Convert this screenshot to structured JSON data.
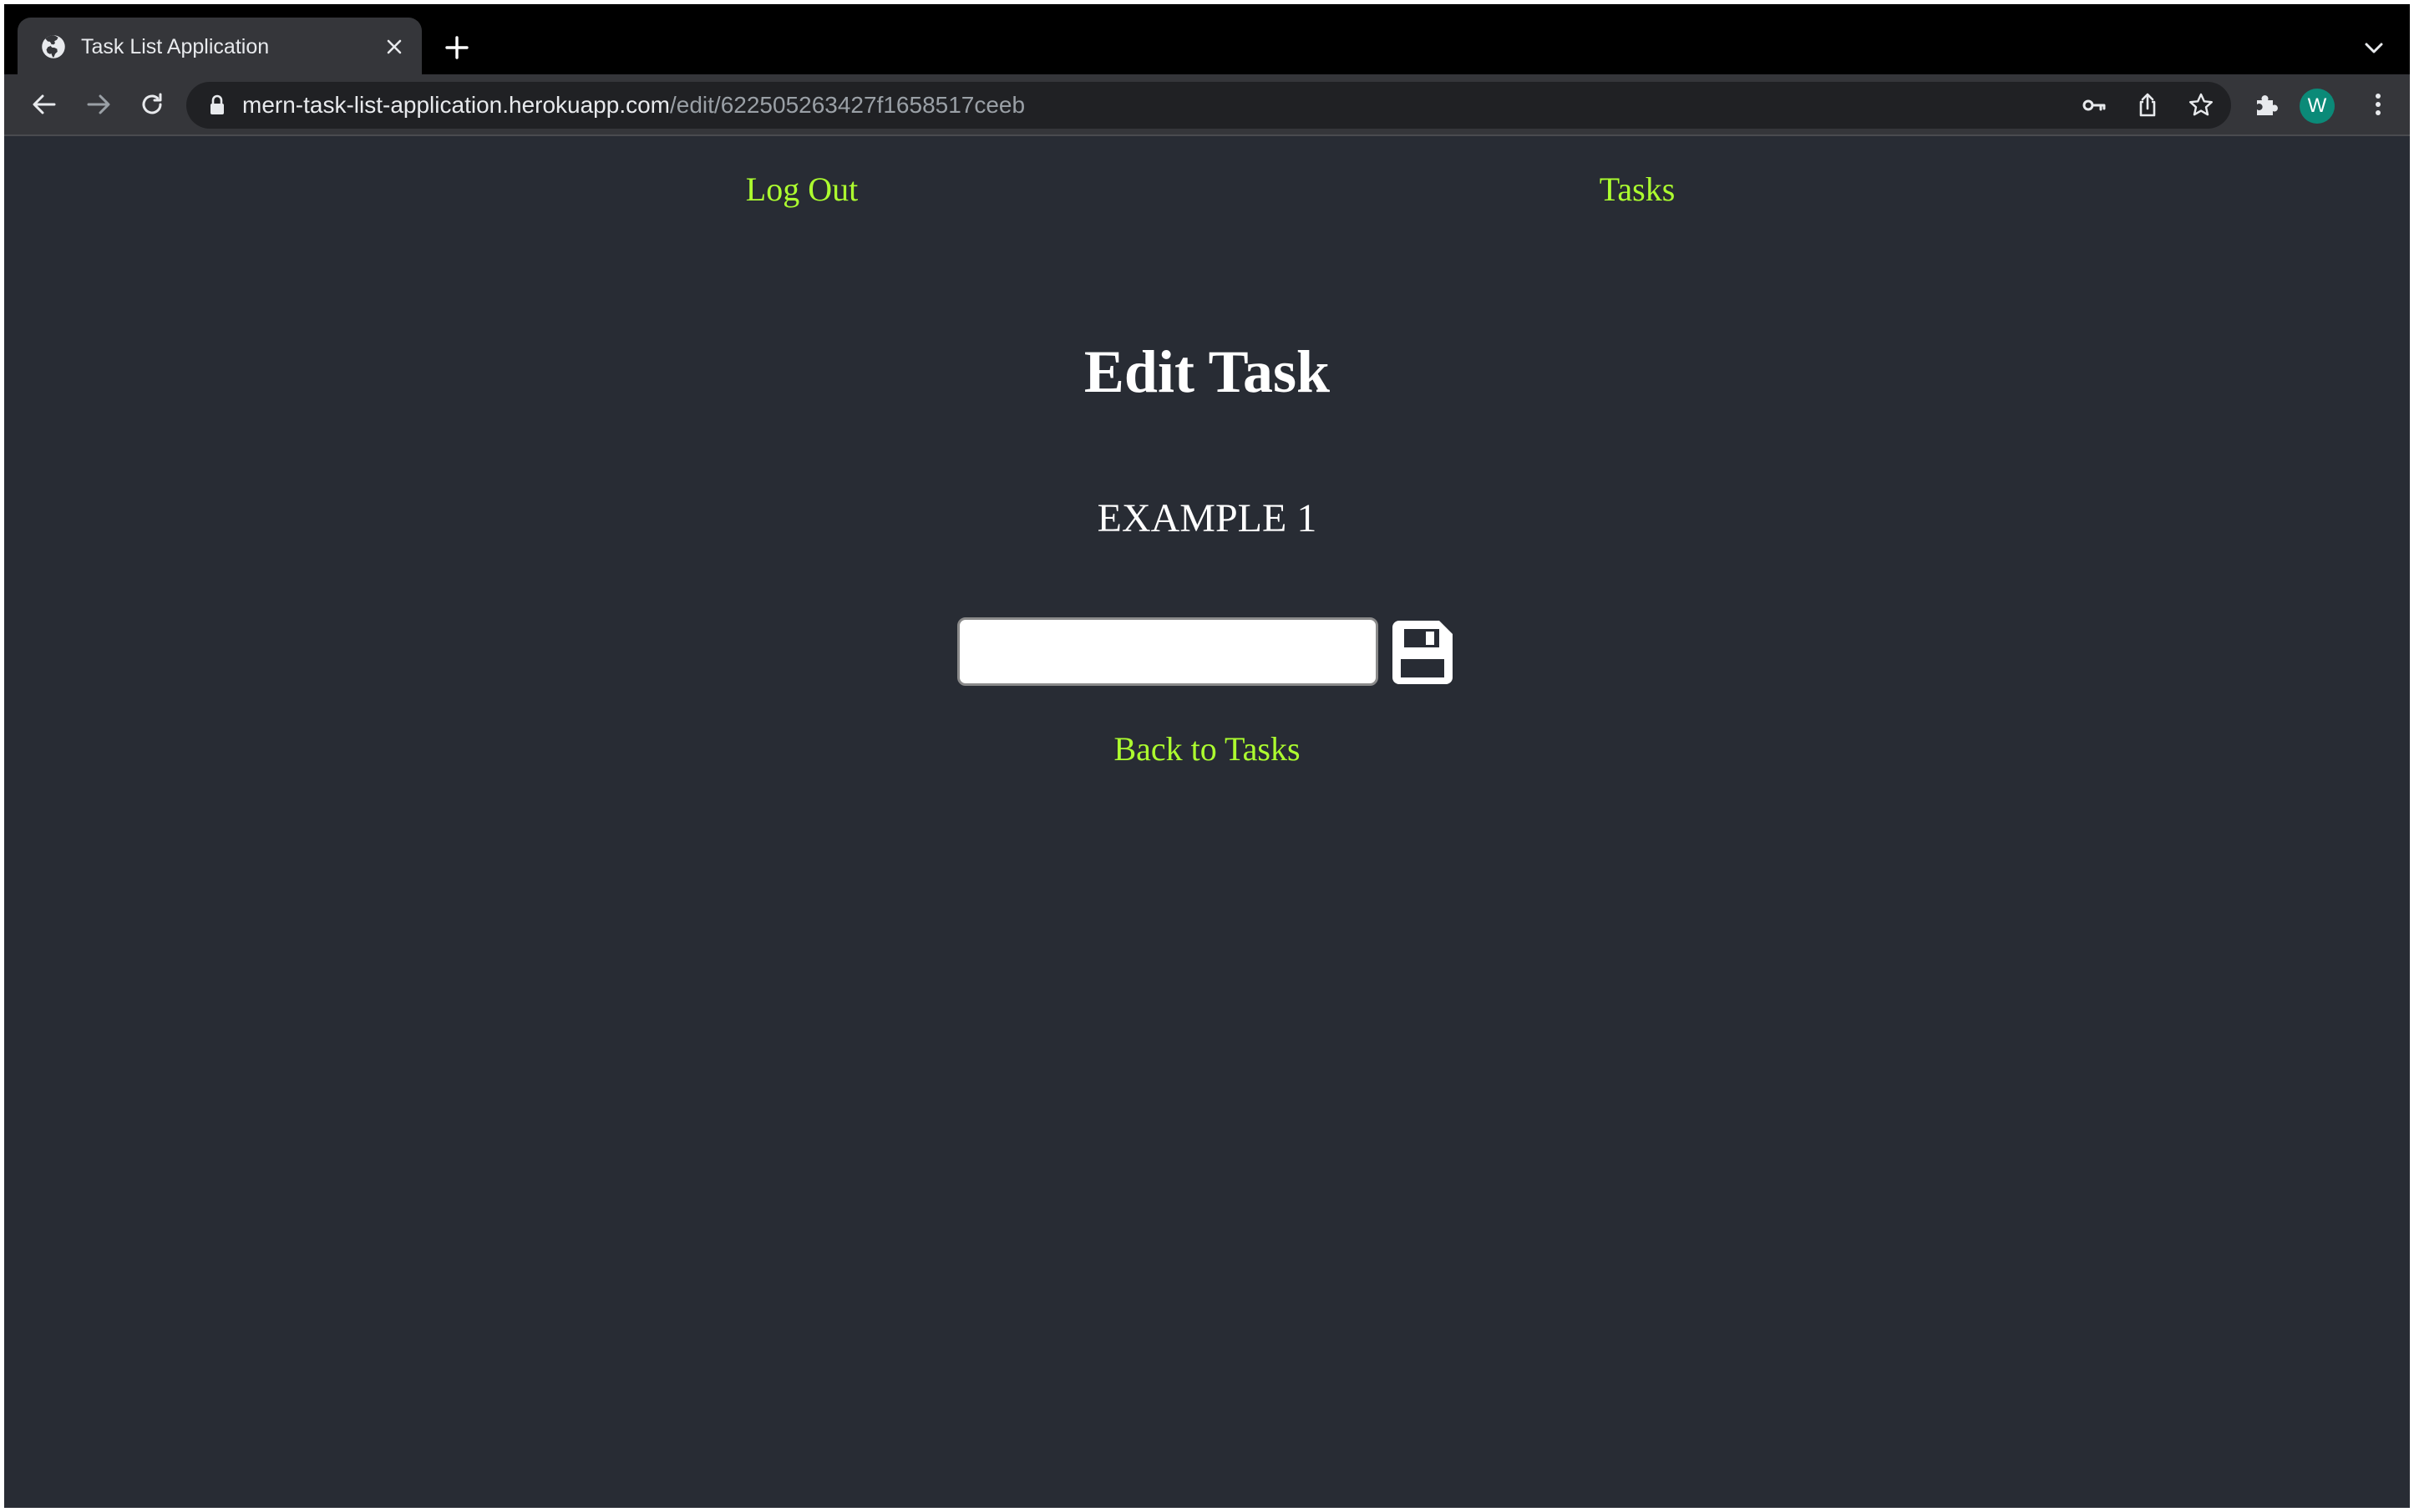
{
  "browser": {
    "tab": {
      "title": "Task List Application",
      "favicon": "globe-icon"
    },
    "address_bar": {
      "host": "mern-task-list-application.herokuapp.com",
      "path": "/edit/622505263427f1658517ceeb"
    },
    "profile": {
      "initial": "W",
      "color": "#0b8a78"
    }
  },
  "nav": {
    "logout_label": "Log Out",
    "tasks_label": "Tasks"
  },
  "main": {
    "title": "Edit Task",
    "task_name": "EXAMPLE 1",
    "input_value": "",
    "save_icon": "floppy-disk-icon",
    "back_label": "Back to Tasks"
  },
  "colors": {
    "page_background": "#282c34",
    "link": "#adff2f",
    "text": "#ffffff"
  }
}
